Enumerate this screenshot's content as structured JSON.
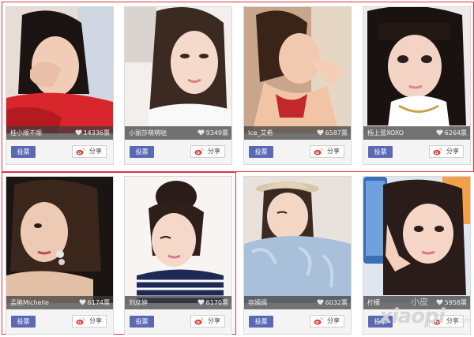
{
  "colors": {
    "highlight_frame": "#e2303a",
    "vote_button": "#5b69b4",
    "info_bar": "#3c3c3c"
  },
  "icons": {
    "votes": "heart-icon",
    "share": "weibo-icon"
  },
  "cards": [
    {
      "name": "桂小顺不顺",
      "votes": "14336票",
      "vote_label": "投票",
      "share_label": "分享"
    },
    {
      "name": "小丽莎萌萌哒",
      "votes": "9349票",
      "vote_label": "投票",
      "share_label": "分享"
    },
    {
      "name": "Ice_艾希",
      "votes": "6587票",
      "vote_label": "投票",
      "share_label": "分享"
    },
    {
      "name": "杨上萱XOXO",
      "votes": "6264票",
      "vote_label": "投票",
      "share_label": "分享"
    },
    {
      "name": "孟鹃Michelle",
      "votes": "6174票",
      "vote_label": "投票",
      "share_label": "分享"
    },
    {
      "name": "刘彦婷",
      "votes": "6170票",
      "vote_label": "投票",
      "share_label": "分享"
    },
    {
      "name": "容嫣嫣",
      "votes": "6032票",
      "vote_label": "投票",
      "share_label": "分享"
    },
    {
      "name": "柠檬",
      "votes": "5958票",
      "vote_label": "投票",
      "share_label": "分享"
    }
  ],
  "watermark": {
    "brand": "xiaopi",
    "small": "小皮",
    "suffix": ".com"
  }
}
